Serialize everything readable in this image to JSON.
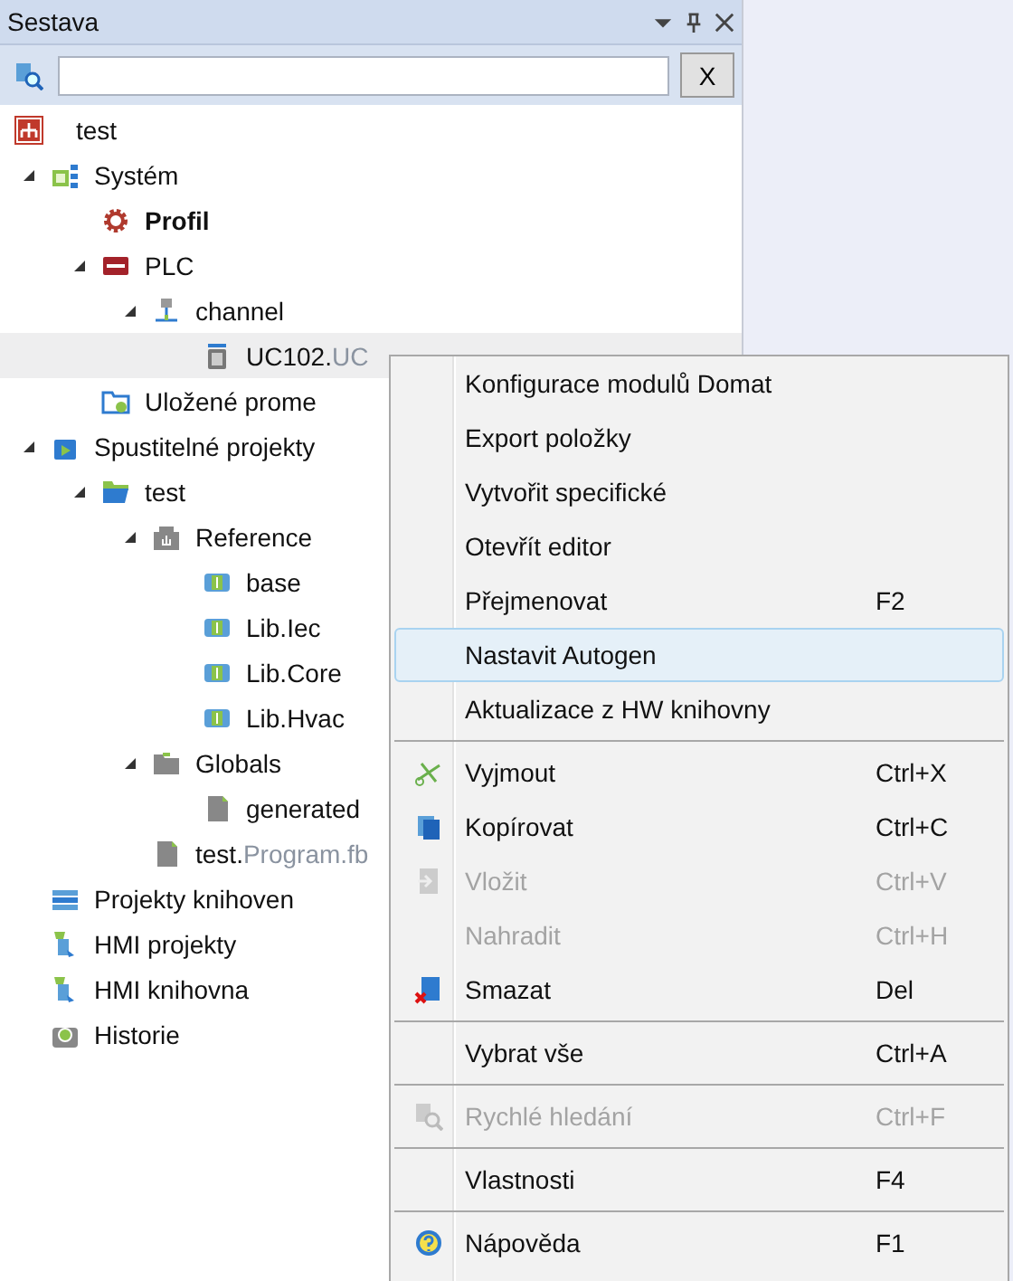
{
  "panel": {
    "title": "Sestava",
    "clear_button": "X"
  },
  "project": {
    "label": "test"
  },
  "tree": [
    {
      "label": "Systém",
      "kind": "system",
      "expanded": true,
      "selected": false,
      "children": [
        {
          "label": "Profil",
          "kind": "profile",
          "bold": true,
          "selected": false
        },
        {
          "label": "PLC",
          "kind": "plc",
          "expanded": true,
          "selected": false,
          "children": [
            {
              "label": "channel",
              "kind": "network",
              "expanded": true,
              "selected": false,
              "children": [
                {
                  "label": "UC102.",
                  "suffix": "UC",
                  "kind": "module",
                  "selected": true
                }
              ]
            }
          ]
        },
        {
          "label": "Uložené prome",
          "kind": "saved",
          "selected": false
        }
      ]
    },
    {
      "label": "Spustitelné projekty",
      "kind": "runnable",
      "expanded": true,
      "selected": false,
      "children": [
        {
          "label": "test",
          "kind": "folder",
          "expanded": true,
          "selected": false,
          "children": [
            {
              "label": "Reference",
              "kind": "references",
              "expanded": true,
              "selected": false,
              "children": [
                {
                  "label": "base",
                  "kind": "library",
                  "selected": false
                },
                {
                  "label": "Lib.Iec",
                  "kind": "library",
                  "selected": false
                },
                {
                  "label": "Lib.Core",
                  "kind": "library",
                  "selected": false
                },
                {
                  "label": "Lib.Hvac",
                  "kind": "library",
                  "selected": false
                }
              ]
            },
            {
              "label": "Globals",
              "kind": "greyfolder",
              "expanded": true,
              "selected": false,
              "children": [
                {
                  "label": "generated",
                  "kind": "file",
                  "selected": false
                }
              ]
            },
            {
              "label": "test.",
              "suffix": "Program.fb",
              "kind": "file",
              "selected": false
            }
          ]
        }
      ]
    },
    {
      "label": "Projekty knihoven",
      "kind": "stack",
      "selected": false
    },
    {
      "label": "HMI projekty",
      "kind": "hmi",
      "selected": false
    },
    {
      "label": "HMI knihovna",
      "kind": "hmi",
      "selected": false
    },
    {
      "label": "Historie",
      "kind": "history",
      "selected": false
    }
  ],
  "menu": [
    [
      {
        "label": "Konfigurace modulů Domat",
        "kind": "plain",
        "disabled": false,
        "hovered": false
      },
      {
        "label": "Export položky",
        "kind": "plain",
        "disabled": false,
        "hovered": false
      },
      {
        "label": "Vytvořit specifické",
        "kind": "plain",
        "disabled": false,
        "hovered": false
      },
      {
        "label": "Otevřít editor",
        "kind": "plain",
        "disabled": false,
        "hovered": false
      },
      {
        "label": "Přejmenovat",
        "shortcut": "F2",
        "kind": "plain",
        "disabled": false,
        "hovered": false
      },
      {
        "label": "Nastavit Autogen",
        "kind": "plain",
        "disabled": false,
        "hovered": true
      },
      {
        "label": "Aktualizace z HW knihovny",
        "kind": "plain",
        "disabled": false,
        "hovered": false
      }
    ],
    [
      {
        "label": "Vyjmout",
        "shortcut": "Ctrl+X",
        "kind": "cut",
        "disabled": false,
        "hovered": false
      },
      {
        "label": "Kopírovat",
        "shortcut": "Ctrl+C",
        "kind": "copy",
        "disabled": false,
        "hovered": false
      },
      {
        "label": "Vložit",
        "shortcut": "Ctrl+V",
        "kind": "paste",
        "disabled": true,
        "hovered": false
      },
      {
        "label": "Nahradit",
        "shortcut": "Ctrl+H",
        "kind": "plain",
        "disabled": true,
        "hovered": false
      },
      {
        "label": "Smazat",
        "shortcut": "Del",
        "kind": "delete",
        "disabled": false,
        "hovered": false
      }
    ],
    [
      {
        "label": "Vybrat vše",
        "shortcut": "Ctrl+A",
        "kind": "plain",
        "disabled": false,
        "hovered": false
      }
    ],
    [
      {
        "label": "Rychlé hledání",
        "shortcut": "Ctrl+F",
        "kind": "find",
        "disabled": true,
        "hovered": false
      }
    ],
    [
      {
        "label": "Vlastnosti",
        "shortcut": "F4",
        "kind": "plain",
        "disabled": false,
        "hovered": false
      }
    ],
    [
      {
        "label": "Nápověda",
        "shortcut": "F1",
        "kind": "help",
        "disabled": false,
        "hovered": false
      }
    ]
  ]
}
